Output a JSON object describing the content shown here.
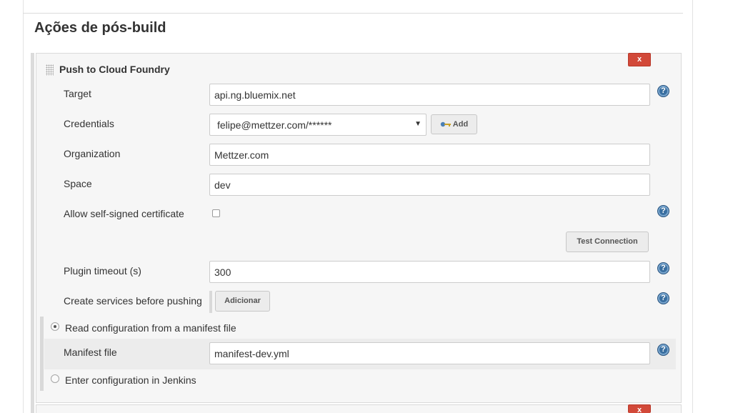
{
  "section": {
    "title": "Ações de pós-build"
  },
  "step": {
    "title": "Push to Cloud Foundry",
    "delete_label": "x"
  },
  "fields": {
    "target": {
      "label": "Target",
      "value": "api.ng.bluemix.net"
    },
    "credentials": {
      "label": "Credentials",
      "value": "felipe@mettzer.com/******",
      "add_label": "Add"
    },
    "organization": {
      "label": "Organization",
      "value": "Mettzer.com"
    },
    "space": {
      "label": "Space",
      "value": "dev"
    },
    "self_signed": {
      "label": "Allow self-signed certificate",
      "checked": false
    },
    "test_connection_label": "Test Connection",
    "timeout": {
      "label": "Plugin timeout (s)",
      "value": "300"
    },
    "services": {
      "label": "Create services before pushing",
      "add_label": "Adicionar"
    }
  },
  "config_mode": {
    "manifest_option": "Read configuration from a manifest file",
    "manifest_file_label": "Manifest file",
    "manifest_file_value": "manifest-dev.yml",
    "jenkins_option": "Enter configuration in Jenkins",
    "selected": "manifest"
  },
  "help_glyph": "?",
  "icons": [
    "key-icon",
    "help-icon",
    "drag-handle-icon",
    "dropdown-caret-icon"
  ],
  "colors": {
    "delete": "#d24939",
    "help": "#3a6fa0"
  }
}
